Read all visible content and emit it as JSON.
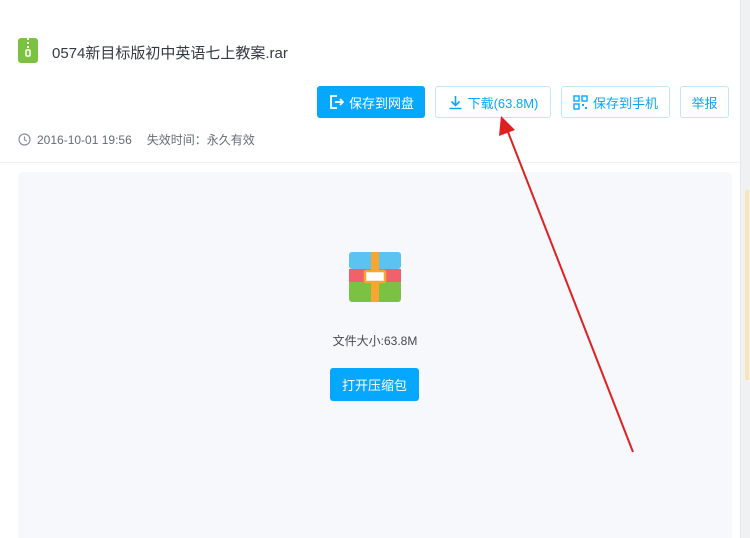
{
  "file": {
    "name": "0574新目标版初中英语七上教案.rar",
    "icon": "zip-file-icon"
  },
  "toolbar": {
    "save_to_disk": "保存到网盘",
    "download": "下载(63.8M)",
    "save_to_phone": "保存到手机",
    "report": "举报"
  },
  "meta": {
    "upload_time": "2016-10-01 19:56",
    "expire": "失效时间：永久有效"
  },
  "preview": {
    "file_size": "文件大小:63.8M",
    "open_archive": "打开压缩包"
  },
  "colors": {
    "accent": "#06a7ff",
    "annotation_arrow": "#e02020"
  }
}
